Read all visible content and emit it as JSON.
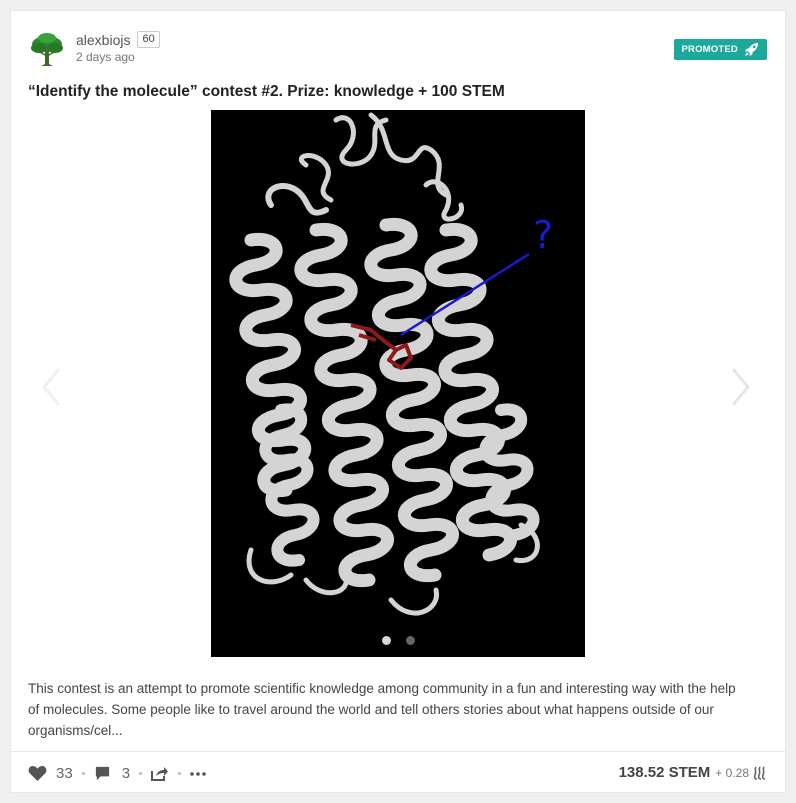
{
  "post": {
    "author": "alexbiojs",
    "reputation": "60",
    "time": "2 days ago",
    "promoted_label": "PROMOTED",
    "title": "“Identify the molecule” contest #2. Prize: knowledge + 100 STEM",
    "image": {
      "question_mark": "?",
      "slides_total": 2,
      "slide_active": 1
    },
    "excerpt": "This contest is an attempt to promote scientific knowledge among community in a fun and interesting way with the help of molecules. Some people like to travel around the world and tell others stories about what happens outside of our organisms/cel..."
  },
  "footer": {
    "likes": "33",
    "comments": "3",
    "payout": "138.52 STEM",
    "steem_extra": "+ 0.28"
  },
  "colors": {
    "promoted_bg": "#1aa99a",
    "image_bg": "#000000",
    "ligand": "#8b1a1a",
    "pointer": "#1a1acc"
  },
  "icons": [
    "tree-avatar-icon",
    "rocket-icon",
    "chevron-left-icon",
    "chevron-right-icon",
    "heart-icon",
    "comment-icon",
    "share-icon",
    "more-icon",
    "steem-icon"
  ]
}
